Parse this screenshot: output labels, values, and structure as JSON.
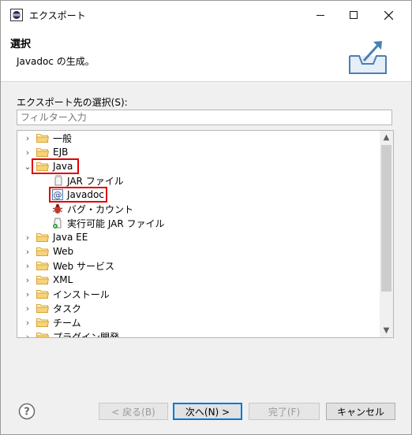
{
  "window": {
    "title": "エクスポート",
    "minimize": "—",
    "maximize": "☐",
    "close": "✕"
  },
  "header": {
    "title": "選択",
    "description": "Javadoc の生成。"
  },
  "section_label": "エクスポート先の選択(S):",
  "filter": {
    "value": "",
    "placeholder": "フィルター入力"
  },
  "tree": {
    "items": [
      {
        "label": "一般"
      },
      {
        "label": "EJB"
      },
      {
        "label": "Java"
      },
      {
        "label": "JAR ファイル"
      },
      {
        "label": "Javadoc"
      },
      {
        "label": "バグ・カウント"
      },
      {
        "label": "実行可能 JAR ファイル"
      },
      {
        "label": "Java EE"
      },
      {
        "label": "Web"
      },
      {
        "label": "Web サービス"
      },
      {
        "label": "XML"
      },
      {
        "label": "インストール"
      },
      {
        "label": "タスク"
      },
      {
        "label": "チーム"
      },
      {
        "label": "プラグイン開発"
      }
    ]
  },
  "buttons": {
    "back": "< 戻る(B)",
    "next": "次へ(N) >",
    "finish": "完了(F)",
    "cancel": "キャンセル"
  },
  "colors": {
    "highlight": "#e00000",
    "folder": "#e8b84a",
    "accent": "#0078d7"
  }
}
